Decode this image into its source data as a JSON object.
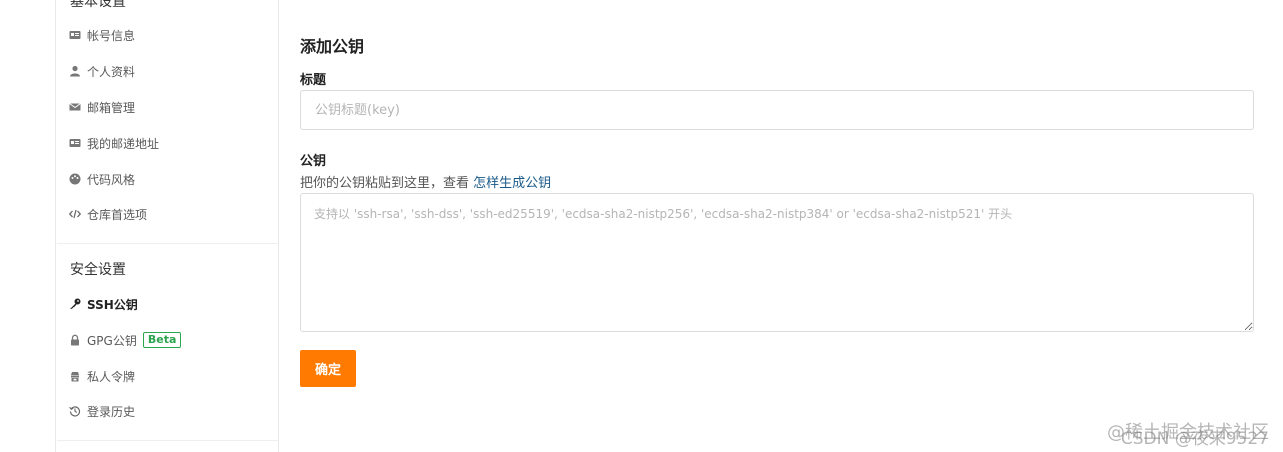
{
  "sidebar": {
    "basic_group_title": "基本设置",
    "basic_items": [
      {
        "label": "帐号信息",
        "icon": "id-card-icon"
      },
      {
        "label": "个人资料",
        "icon": "user-icon"
      },
      {
        "label": "邮箱管理",
        "icon": "mail-icon"
      },
      {
        "label": "我的邮递地址",
        "icon": "address-card-icon"
      },
      {
        "label": "代码风格",
        "icon": "palette-icon"
      },
      {
        "label": "仓库首选项",
        "icon": "code-icon"
      }
    ],
    "security_group_title": "安全设置",
    "security_items": [
      {
        "label": "SSH公钥",
        "icon": "key-icon",
        "active": true
      },
      {
        "label": "GPG公钥",
        "icon": "lock-icon",
        "badge": "Beta"
      },
      {
        "label": "私人令牌",
        "icon": "token-icon"
      },
      {
        "label": "登录历史",
        "icon": "history-icon"
      }
    ]
  },
  "form": {
    "title": "添加公钥",
    "title_label": "标题",
    "title_placeholder": "公钥标题(key)",
    "key_label": "公钥",
    "key_hint_text": "把你的公钥粘贴到这里，查看",
    "key_hint_link": "怎样生成公钥",
    "key_placeholder": "支持以 'ssh-rsa', 'ssh-dss', 'ssh-ed25519', 'ecdsa-sha2-nistp256', 'ecdsa-sha2-nistp384' or 'ecdsa-sha2-nistp521' 开头",
    "submit_label": "确定"
  },
  "watermark": {
    "line1": "@稀土掘金技术社区",
    "line2": "CSDN @夜来9527"
  },
  "colors": {
    "accent": "#ff7a00",
    "link": "#1a5a8a",
    "badge": "#2ea44f"
  }
}
